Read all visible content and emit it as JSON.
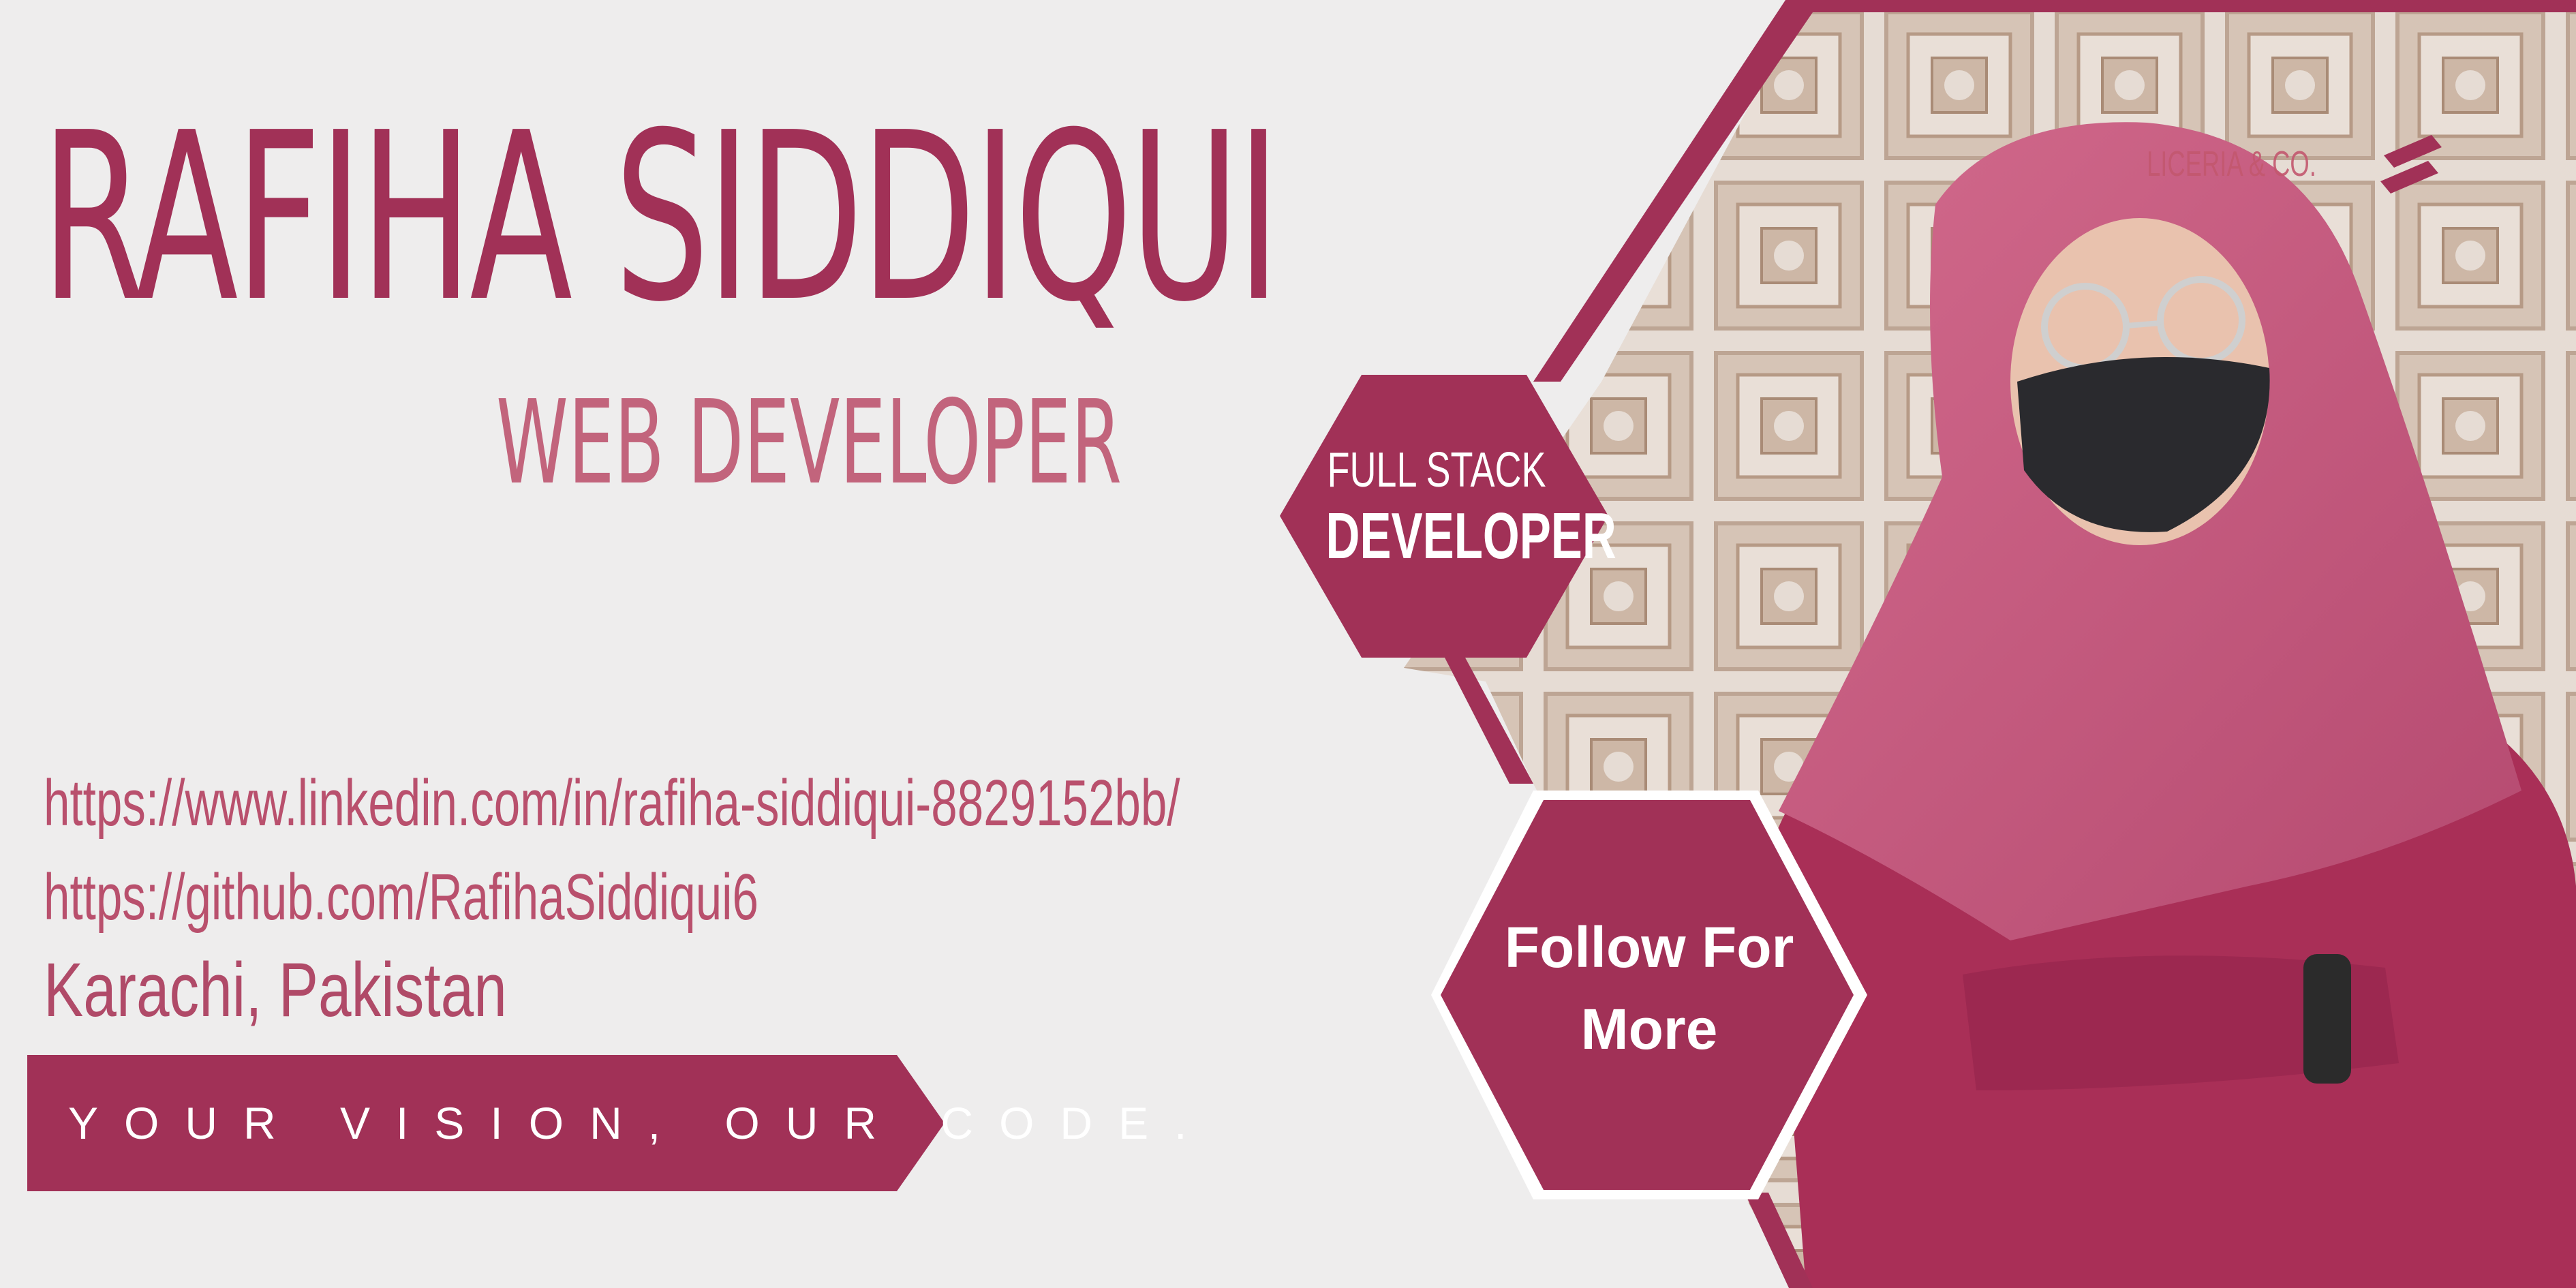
{
  "profile": {
    "name": "RAFIHA SIDDIQUI",
    "role": "WEB DEVELOPER",
    "linkedin": "https://www.linkedin.com/in/rafiha-siddiqui-8829152bb/",
    "github": "https://github.com/RafihaSiddiqui6",
    "location": "Karachi, Pakistan"
  },
  "tagline": "YOUR VISION, OUR CODE.",
  "badges": {
    "full_stack_line1": "FULL STACK",
    "full_stack_line2": "DEVELOPER",
    "follow_line1": "Follow For",
    "follow_line2": "More"
  },
  "brand": {
    "text": "LICERIA & CO."
  },
  "colors": {
    "background": "#eeeded",
    "primary": "#a13157",
    "secondary": "#c2647c",
    "text_light": "#ffffff"
  }
}
